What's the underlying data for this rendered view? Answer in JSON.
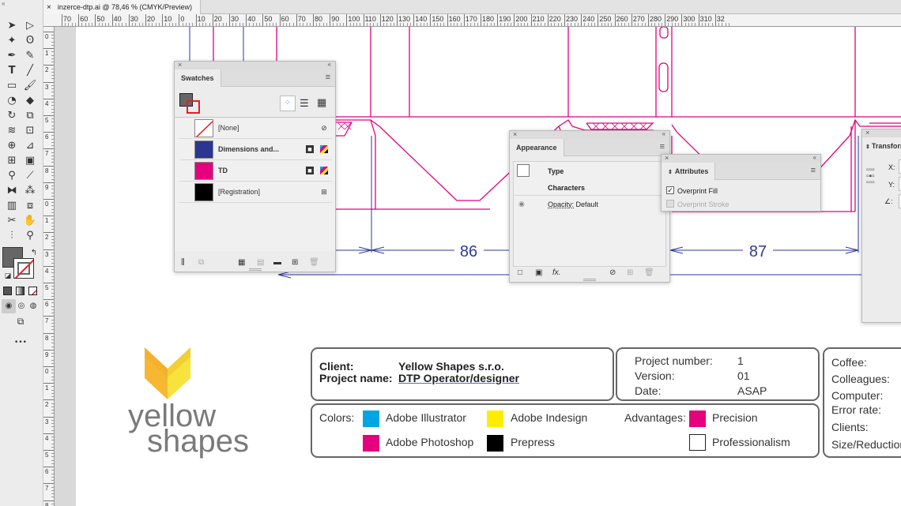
{
  "window": {
    "tab_close": "×",
    "tab_title": "inzerce-dtp.ai @ 78,46 % (CMYK/Preview)"
  },
  "ruler": {
    "h_ticks": [
      "70",
      "60",
      "50",
      "40",
      "30",
      "20",
      "10",
      "0",
      "10",
      "20",
      "30",
      "40",
      "50",
      "60",
      "70",
      "80",
      "90",
      "100",
      "110",
      "120",
      "130",
      "140",
      "150",
      "160",
      "170",
      "180",
      "190",
      "200",
      "210",
      "220",
      "230",
      "240",
      "250",
      "260",
      "270",
      "280",
      "290",
      "300",
      "310",
      "32"
    ],
    "v_ticks": [
      "0",
      "1",
      "2",
      "3",
      "4",
      "5",
      "6",
      "7",
      "8",
      "9",
      "0",
      "1",
      "2",
      "3",
      "4",
      "5",
      "6",
      "7",
      "8",
      "9",
      "0",
      "1",
      "2",
      "3",
      "4",
      "5",
      "6",
      "7",
      "8",
      "9"
    ]
  },
  "toolbar": {
    "more": "•••"
  },
  "swatches": {
    "title": "Swatches",
    "rows": [
      {
        "name": "[None]"
      },
      {
        "name": "Dimensions and..."
      },
      {
        "name": "TD"
      },
      {
        "name": "[Registration]"
      }
    ]
  },
  "appearance": {
    "title": "Appearance",
    "type_label": "Type",
    "characters_label": "Characters",
    "opacity_label": "Opacity:",
    "opacity_value": "Default",
    "fx_label": "fx."
  },
  "attributes": {
    "title": "Attributes",
    "overprint_fill": "Overprint Fill",
    "overprint_stroke": "Overprint Stroke",
    "overprint_fill_checked": true
  },
  "transform": {
    "title": "Transform",
    "x_label": "X:",
    "y_label": "Y:",
    "angle_label": "∠:"
  },
  "dieline": {
    "dim1": "86",
    "dim2": "87"
  },
  "logo": {
    "line1": "yellow",
    "line2": "shapes"
  },
  "info": {
    "client_label": "Client:",
    "client_value": "Yellow Shapes s.r.o.",
    "project_label": "Project name:",
    "project_value": "DTP Operator/designer",
    "project_number_label": "Project number:",
    "project_number_value": "1",
    "version_label": "Version:",
    "version_value": "01",
    "date_label": "Date:",
    "date_value": "ASAP",
    "colors_label": "Colors:",
    "colors": [
      {
        "name": "Adobe Illustrator",
        "color": "#00a6e4"
      },
      {
        "name": "Adobe Indesign",
        "color": "#ffed00"
      },
      {
        "name": "Adobe Photoshop",
        "color": "#e5007e"
      },
      {
        "name": "Prepress",
        "color": "#000000"
      }
    ],
    "advantages_label": "Advantages:",
    "advantages": [
      {
        "name": "Precision",
        "color": "#e5007e"
      },
      {
        "name": "Professionalism",
        "color": "#ffffff"
      }
    ],
    "right_labels": [
      "Coffee:",
      "Colleagues:",
      "Computer:",
      "Error rate:",
      "Clients:",
      "Size/Reduction"
    ]
  },
  "colors": {
    "magenta": "#e5007e",
    "dim_blue": "#2f3a9c",
    "logo_yellow": "#f7e33c",
    "logo_orange": "#f7b733"
  }
}
